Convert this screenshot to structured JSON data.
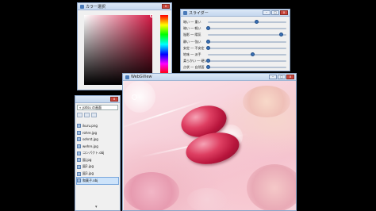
{
  "picker": {
    "title": "カラー選択",
    "color": "#d41a45"
  },
  "sliders": {
    "title": "スライダー",
    "rows": [
      {
        "label": "暗い ― 重い",
        "value": 0.62
      },
      {
        "label": "暗い ― 軽い",
        "value": 0.0
      },
      {
        "label": "陰影 ― 陽気",
        "value": 0.93
      },
      {
        "label": "静い ― 強い",
        "value": 0.0
      },
      {
        "label": "安定 ― 不安定",
        "value": 0.0
      },
      {
        "label": "地味 ― 派手",
        "value": 0.57
      },
      {
        "label": "柔らかい ― 硬い",
        "value": 0.0
      },
      {
        "label": "点状 ― 自然面",
        "value": 0.0
      }
    ]
  },
  "files": {
    "address": "« yatsu の画面",
    "items": [
      {
        "name": "ikuru.png",
        "selected": false
      },
      {
        "name": "rohre.jpg",
        "selected": false
      },
      {
        "name": "sohrst.jpg",
        "selected": false
      },
      {
        "name": "wehre.jpg",
        "selected": false
      },
      {
        "name": "コンパクト.obj",
        "selected": false
      },
      {
        "name": "図.jpg",
        "selected": false
      },
      {
        "name": "図2.jpg",
        "selected": false
      },
      {
        "name": "図3.jpg",
        "selected": false
      },
      {
        "name": "和菓子.obj",
        "selected": true
      }
    ]
  },
  "view3d": {
    "title": "WebGView"
  },
  "colors": {
    "shape": "#c8214b",
    "accent": "#3a6fb3"
  }
}
